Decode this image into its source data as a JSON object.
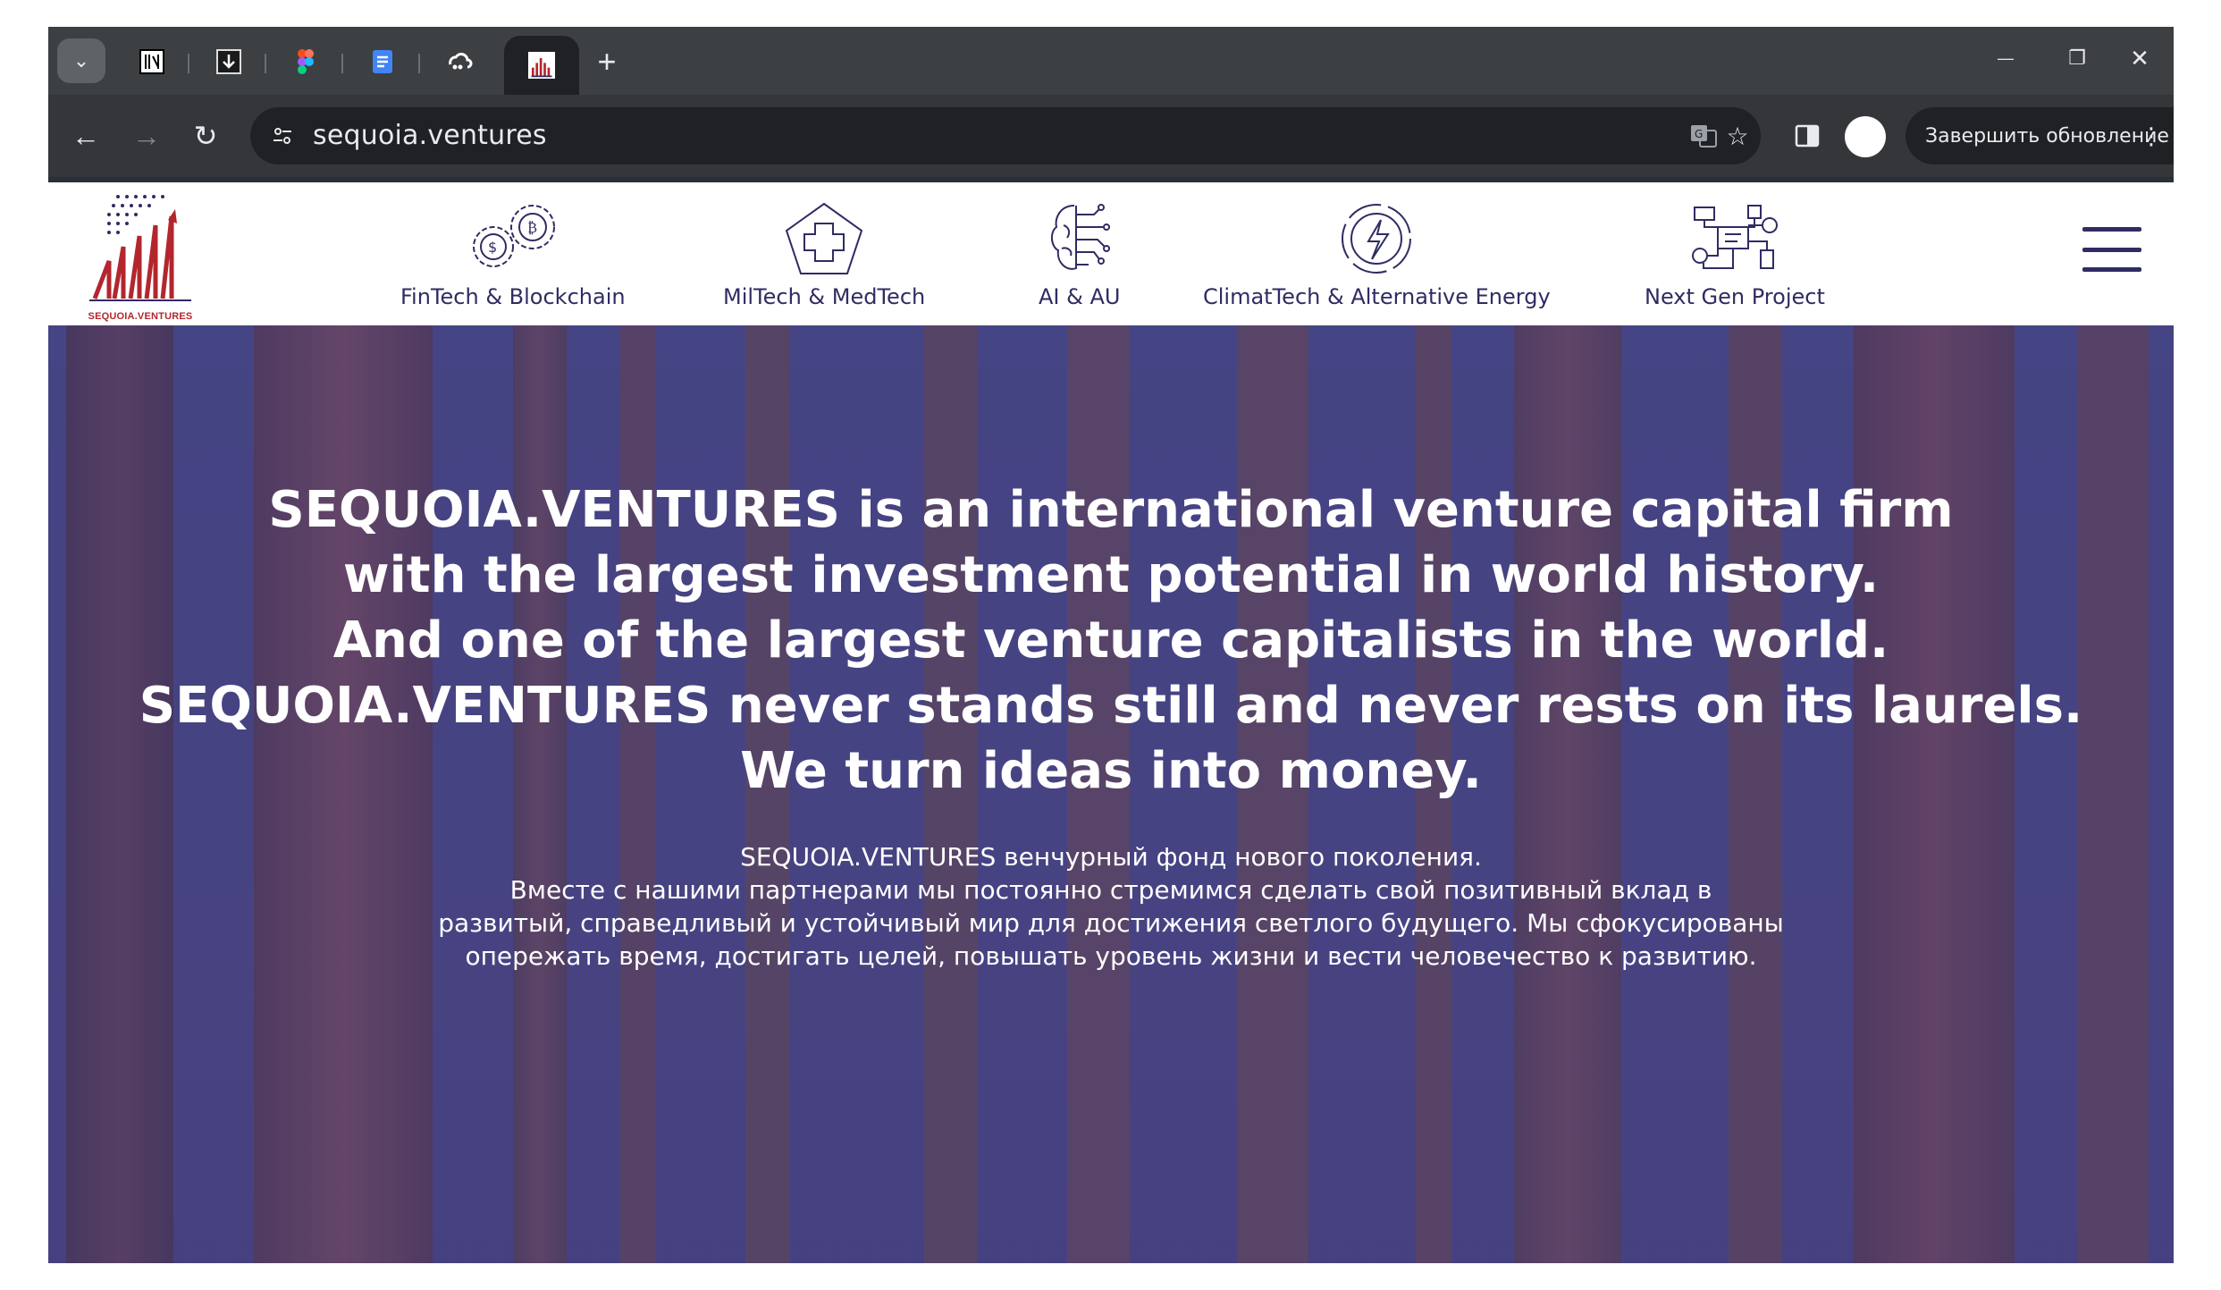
{
  "browser": {
    "tabs": [
      {
        "icon": "notion-icon",
        "active": false
      },
      {
        "icon": "download-manager-icon",
        "active": false
      },
      {
        "icon": "figma-icon",
        "active": false
      },
      {
        "icon": "google-docs-icon",
        "active": false
      },
      {
        "icon": "cloud-app-icon",
        "active": false
      },
      {
        "icon": "sequoia-ventures-favicon",
        "active": true
      }
    ],
    "new_tab_symbol": "+",
    "url": "sequoia.ventures",
    "update_button_label": "Завершить обновление",
    "window_controls": {
      "minimize": "—",
      "restore": "❐",
      "close": "✕"
    },
    "nav": {
      "back": "←",
      "forward": "→",
      "reload": "↻"
    }
  },
  "site": {
    "logo_text": "SEQUOIA.VENTURES",
    "nav_items": [
      {
        "label": "FinTech & Blockchain",
        "icon": "coins-gears-icon"
      },
      {
        "label": "MilTech & MedTech",
        "icon": "medical-cross-icon"
      },
      {
        "label": "AI & AU",
        "icon": "ai-brain-icon"
      },
      {
        "label": "ClimatTech & Alternative Energy",
        "icon": "energy-bolt-icon"
      },
      {
        "label": "Next Gen Project",
        "icon": "circuit-project-icon"
      }
    ],
    "brand_color": "#2f2c63",
    "accent_red": "#b3262e"
  },
  "hero": {
    "headline_lines": [
      "SEQUOIA.VENTURES is an international venture capital firm",
      "with the largest investment potential in world history.",
      "And one of the largest venture capitalists in the world.",
      "SEQUOIA.VENTURES never stands still and never rests on its laurels.",
      "We turn ideas into money."
    ],
    "sub_lines": [
      "SEQUOIA.VENTURES венчурный фонд нового поколения.",
      "Вместе с нашими партнерами мы постоянно стремимся сделать свой позитивный вклад в",
      "развитый, справедливый и устойчивый мир для достижения светлого будущего. Мы сфокусированы",
      "опережать время, достигать целей, повышать уровень жизни и вести человечество к развитию."
    ],
    "overlay_color": "#3e3a80"
  }
}
